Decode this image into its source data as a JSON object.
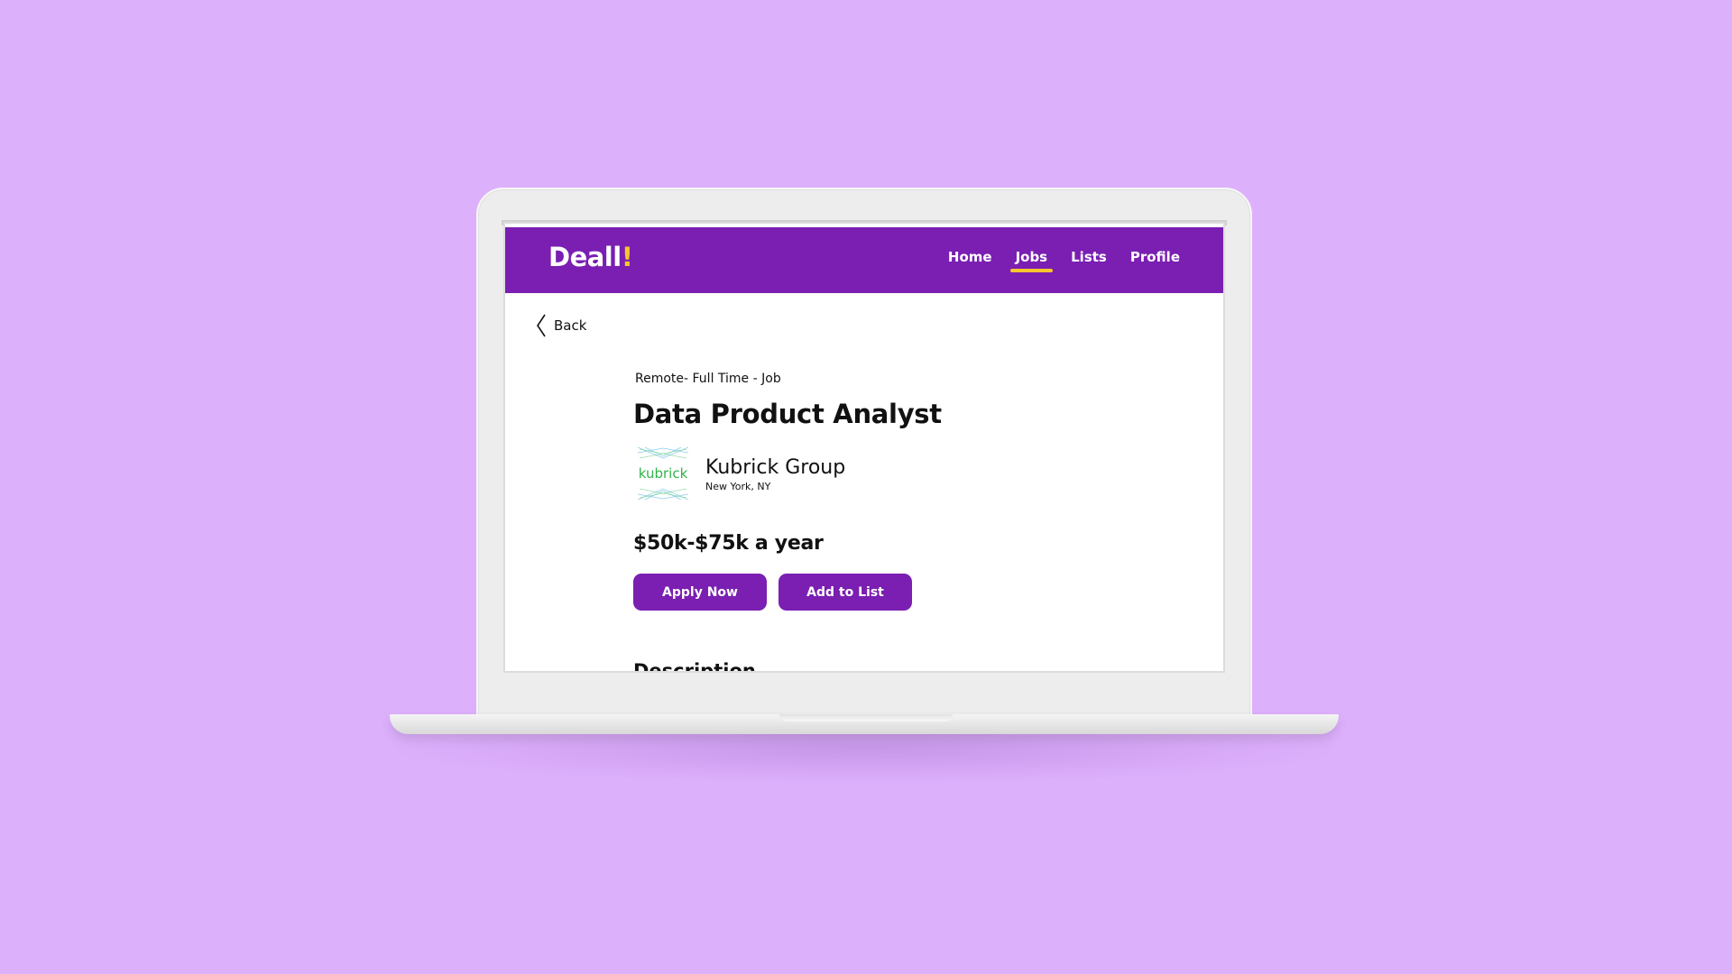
{
  "app": {
    "logo_text": "Deall",
    "logo_accent": "!"
  },
  "nav": {
    "items": [
      {
        "label": "Home",
        "active": false
      },
      {
        "label": "Jobs",
        "active": true
      },
      {
        "label": "Lists",
        "active": false
      },
      {
        "label": "Profile",
        "active": false
      }
    ]
  },
  "back": {
    "label": "Back",
    "icon": "chevron-left-icon"
  },
  "job": {
    "type_line": "Remote- Full Time - Job",
    "title": "Data Product Analyst",
    "company": {
      "name": "Kubrick Group",
      "location": "New York, NY",
      "logo_text": "kubrick"
    },
    "salary": "$50k-$75k a year",
    "actions": {
      "apply_label": "Apply Now",
      "add_to_list_label": "Add to List"
    },
    "description_heading": "Description"
  },
  "colors": {
    "background": "#ddb0fc",
    "brand_purple": "#7a1fb2",
    "accent_yellow": "#f7c52c",
    "logo_green": "#2fb34a"
  }
}
